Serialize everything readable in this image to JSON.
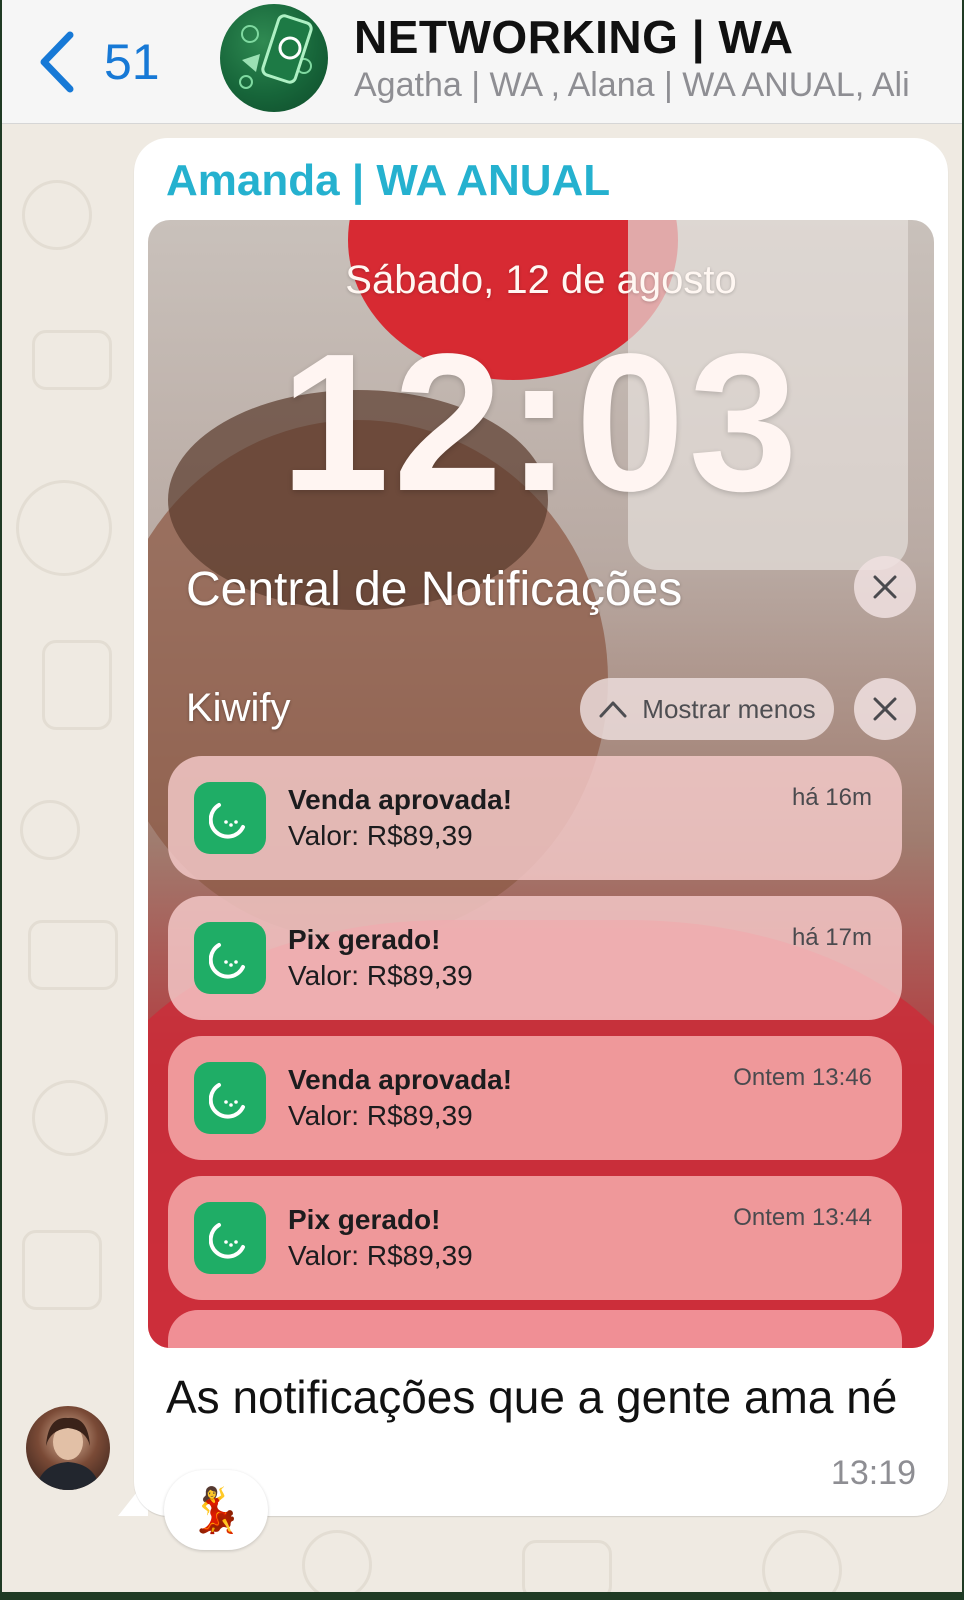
{
  "header": {
    "unread_count": "51",
    "group_title": "NETWORKING | WA",
    "group_members": "Agatha | WA , Alana | WA ANUAL, Ali"
  },
  "message": {
    "sender_name": "Amanda | WA ANUAL",
    "text": "As notificações que a gente ama né",
    "time": "13:19",
    "reaction": "💃"
  },
  "lock_screen": {
    "date": "Sábado, 12 de agosto",
    "time": "12:03",
    "notification_center_title": "Central de Notificações",
    "app_group": "Kiwify",
    "show_less_label": "Mostrar menos",
    "notifications": [
      {
        "title": "Venda aprovada!",
        "body": "Valor: R$89,39",
        "time": "há 16m"
      },
      {
        "title": "Pix gerado!",
        "body": "Valor: R$89,39",
        "time": "há 17m"
      },
      {
        "title": "Venda aprovada!",
        "body": "Valor: R$89,39",
        "time": "Ontem 13:46"
      },
      {
        "title": "Pix gerado!",
        "body": "Valor: R$89,39",
        "time": "Ontem 13:44"
      }
    ]
  },
  "colors": {
    "accent_blue": "#1779d6",
    "sender_name": "#25b1cf",
    "kiwify_green": "#1fad66",
    "chat_background": "#efeae2"
  }
}
